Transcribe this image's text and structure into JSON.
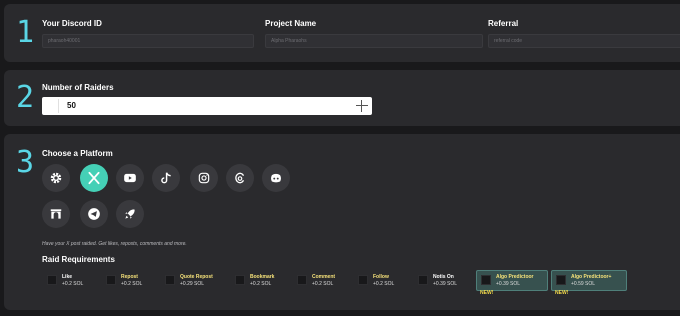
{
  "step1": {
    "number": "1",
    "discord": {
      "label": "Your Discord ID",
      "value": "pharaoh40001"
    },
    "project": {
      "label": "Project Name",
      "value": "Alpha Pharaohs"
    },
    "referral": {
      "label": "Referral",
      "placeholder": "referral code"
    }
  },
  "step2": {
    "number": "2",
    "label": "Number of Raiders",
    "value": "50"
  },
  "step3": {
    "number": "3",
    "label": "Choose a Platform",
    "platforms": [
      {
        "icon": "gear-icon"
      },
      {
        "icon": "x-icon",
        "selected": true
      },
      {
        "icon": "youtube-icon"
      },
      {
        "icon": "tiktok-icon"
      },
      {
        "icon": "instagram-icon"
      },
      {
        "icon": "threads-icon"
      },
      {
        "icon": "discord-icon"
      },
      {
        "icon": "arch-icon"
      },
      {
        "icon": "telegram-icon"
      },
      {
        "icon": "rocket-icon"
      }
    ],
    "description": "Have your X post raided. Get likes, reposts, comments and more.",
    "requirements_label": "Raid Requirements",
    "requirements": [
      {
        "name": "Like",
        "price": "+0.2 SOL"
      },
      {
        "name": "Repost",
        "price": "+0.2 SOL"
      },
      {
        "name": "Quote Repost",
        "price": "+0.29 SOL"
      },
      {
        "name": "Bookmark",
        "price": "+0.2 SOL"
      },
      {
        "name": "Comment",
        "price": "+0.2 SOL"
      },
      {
        "name": "Follow",
        "price": "+0.2 SOL"
      },
      {
        "name": "Notis On",
        "price": "+0.39 SOL"
      },
      {
        "name": "Algo Predictoor",
        "price": "+0.39 SOL",
        "badge": "NEW!"
      },
      {
        "name": "Algo Predictoor+",
        "price": "+0.59 SOL",
        "badge": "NEW!"
      }
    ]
  },
  "colors": {
    "accent": "#5ad6e6",
    "selected_platform": "#45d0b6",
    "new_badge": "#f2d84a",
    "name_yellow": "#f6e27a"
  }
}
